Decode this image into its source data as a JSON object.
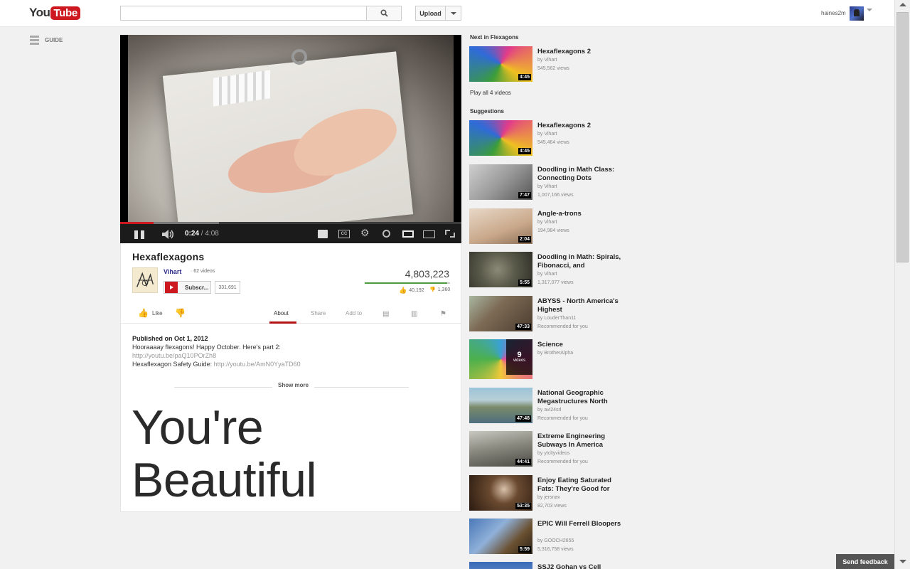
{
  "header": {
    "logo_you": "You",
    "logo_tube": "Tube",
    "search_value": "",
    "upload_label": "Upload",
    "username": "haines2m"
  },
  "guide": {
    "label": "GUIDE"
  },
  "player": {
    "current_time": "0:24",
    "separator": "/",
    "duration": "4:08",
    "played_fraction": 0.097,
    "buffered_fraction": 0.29
  },
  "video": {
    "title": "Hexaflexagons",
    "channel": "Vihart",
    "channel_videos": "62 videos",
    "subscribe_label": "Subscr...",
    "subscriber_count": "331,691",
    "views": "4,803,223",
    "likes": "40,192",
    "dislikes": "1,360",
    "like_fraction": 0.967
  },
  "actions": {
    "like_label": "Like",
    "tabs": [
      "About",
      "Share",
      "Add to"
    ]
  },
  "description": {
    "published": "Published on Oct 1, 2012",
    "line1": "Hooraaaay flexagons! Happy October. Here's part 2:",
    "link1": "http://youtu.be/paQ10POrZh8",
    "safety_prefix": "Hexaflexagon Safety Guide: ",
    "link2": "http://youtu.be/AmN0YyaTD60",
    "show_more": "Show more"
  },
  "overlay_text": {
    "line1": "You're",
    "line2": "Beautiful"
  },
  "sidebar": {
    "next_heading": "Next in Flexagons",
    "next_item": {
      "title": "Hexaflexagons 2",
      "by": "by Vihart",
      "meta": "545,562 views",
      "duration": "4:45"
    },
    "play_all": "Play all 4 videos",
    "suggestions_heading": "Suggestions",
    "suggestions": [
      {
        "title": "Hexaflexagons 2",
        "by": "by Vihart",
        "meta": "545,464 views",
        "duration": "4:45"
      },
      {
        "title": "Doodling in Math Class: Connecting Dots",
        "by": "by Vihart",
        "meta": "1,007,166 views",
        "duration": "7:47"
      },
      {
        "title": "Angle-a-trons",
        "by": "by Vihart",
        "meta": "194,984 views",
        "duration": "2:04"
      },
      {
        "title": "Doodling in Math: Spirals, Fibonacci, and",
        "by": "by Vihart",
        "meta": "1,317,077 views",
        "duration": "5:55"
      },
      {
        "title": "ABYSS - North America's Highest",
        "by": "by LouderThan11",
        "meta": "Recommended for you",
        "duration": "47:33"
      },
      {
        "title": "Science",
        "by": "by BrotherAlpha",
        "meta": "",
        "duration": "",
        "playlist_count": "9",
        "playlist_label": "videos"
      },
      {
        "title": "National Geographic Megastructures North",
        "by": "by avi24srl",
        "meta": "Recommended for you",
        "duration": "47:48"
      },
      {
        "title": "Extreme Engineering Subways In America",
        "by": "by ytcltyvideos",
        "meta": "Recommended for you",
        "duration": "44:41"
      },
      {
        "title": "Enjoy Eating Saturated Fats: They're Good for",
        "by": "by jersnav",
        "meta": "82,703 views",
        "duration": "53:35"
      },
      {
        "title": "EPIC Will Ferrell Bloopers",
        "by": "by GOOCH2655",
        "meta": "5,316,758 views",
        "duration": "5:59"
      },
      {
        "title": "SSJ2 Gohan vs Cell",
        "by": "",
        "meta": "",
        "duration": ""
      }
    ]
  },
  "feedback_label": "Send feedback",
  "colors": {
    "brand_red": "#cc181e",
    "like_green": "#4f9a3e",
    "channel_link": "#2b2b8a"
  }
}
